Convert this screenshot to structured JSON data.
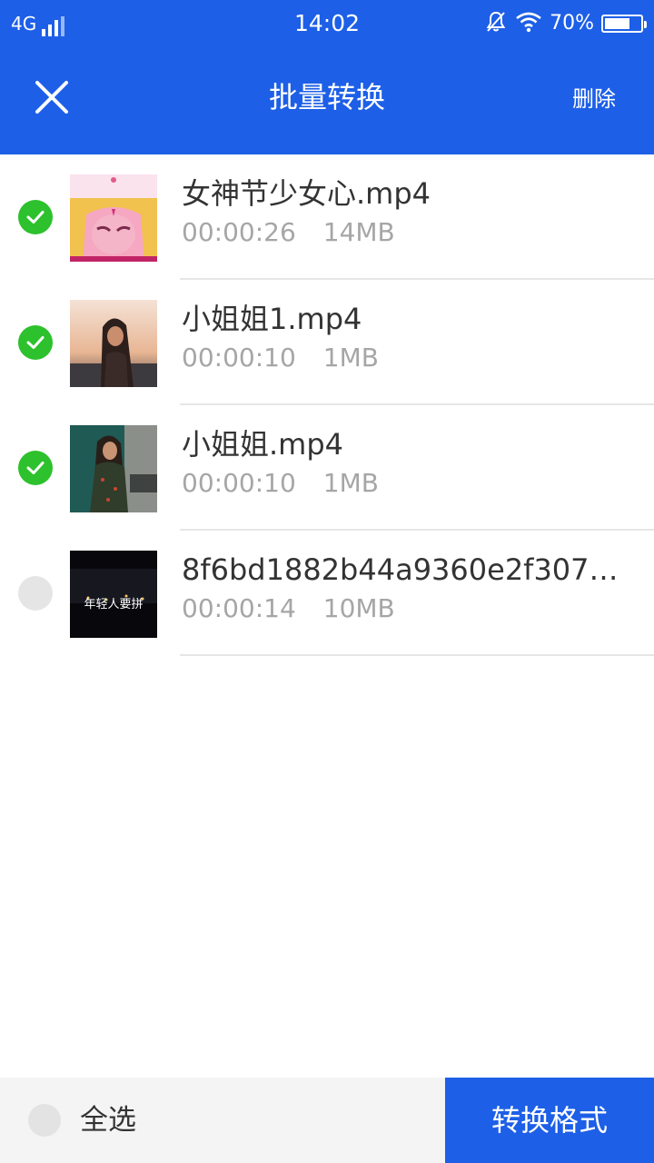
{
  "status_bar": {
    "network": "4G",
    "time": "14:02",
    "battery": "70%",
    "battery_level": 0.7,
    "icons": [
      "signal-icon",
      "mute-bell-icon",
      "wifi-icon",
      "battery-icon"
    ]
  },
  "header": {
    "title": "批量转换",
    "delete_label": "删除",
    "close_icon": "close-icon"
  },
  "colors": {
    "primary": "#1d5fe7",
    "checked": "#2dc12d",
    "unchecked": "#e5e5e5",
    "secondary_text": "#a6a6a6"
  },
  "files": [
    {
      "name": "女神节少女心.mp4",
      "duration": "00:00:26",
      "size": "14MB",
      "selected": true
    },
    {
      "name": "小姐姐1.mp4",
      "duration": "00:00:10",
      "size": "1MB",
      "selected": true
    },
    {
      "name": "小姐姐.mp4",
      "duration": "00:00:10",
      "size": "1MB",
      "selected": true
    },
    {
      "name": "8f6bd1882b44a9360e2f307…",
      "duration": "00:00:14",
      "size": "10MB",
      "selected": false,
      "thumb_caption": "年轻人要拼"
    }
  ],
  "footer": {
    "select_all_label": "全选",
    "select_all_checked": false,
    "convert_label": "转换格式"
  }
}
